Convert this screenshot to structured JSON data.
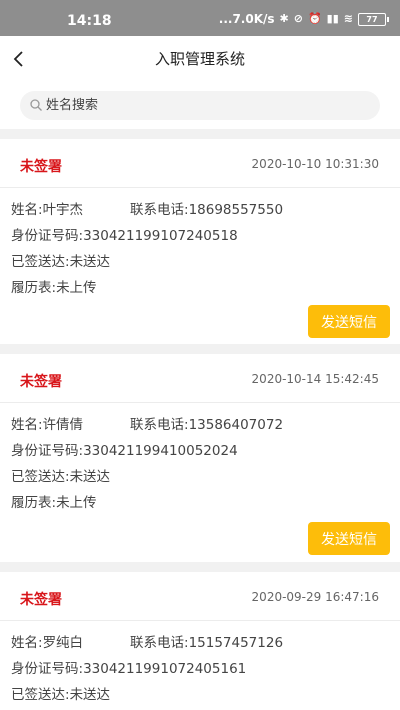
{
  "status_bar": {
    "time": "14:18",
    "net_speed": "...7.0K/s",
    "battery": "77"
  },
  "nav": {
    "title": "入职管理系统"
  },
  "search": {
    "placeholder": "姓名搜索"
  },
  "cards": [
    {
      "status": "未签署",
      "time": "2020-10-10 10:31:30",
      "name_label": "姓名:",
      "name": "叶宇杰",
      "phone_label": "联系电话:",
      "phone": "18698557550",
      "id_label": "身份证号码:",
      "id": "330421199107240518",
      "delivered_label": "已签送达:",
      "delivered": "未送达",
      "resume_label": "履历表:",
      "resume": "未上传",
      "button": "发送短信"
    },
    {
      "status": "未签署",
      "time": "2020-10-14 15:42:45",
      "name_label": "姓名:",
      "name": "许倩倩",
      "phone_label": "联系电话:",
      "phone": "13586407072",
      "id_label": "身份证号码:",
      "id": "330421199410052024",
      "delivered_label": "已签送达:",
      "delivered": "未送达",
      "resume_label": "履历表:",
      "resume": "未上传",
      "button": "发送短信"
    },
    {
      "status": "未签署",
      "time": "2020-09-29 16:47:16",
      "name_label": "姓名:",
      "name": "罗纯白",
      "phone_label": "联系电话:",
      "phone": "15157457126",
      "id_label": "身份证号码:",
      "id": "330421199107240516​1",
      "delivered_label": "已签送达:",
      "delivered": "未送达"
    }
  ],
  "colors": {
    "status_text": "#d8161b",
    "button_bg": "#fdbd0a",
    "status_bar_bg": "#8e8e8e"
  }
}
